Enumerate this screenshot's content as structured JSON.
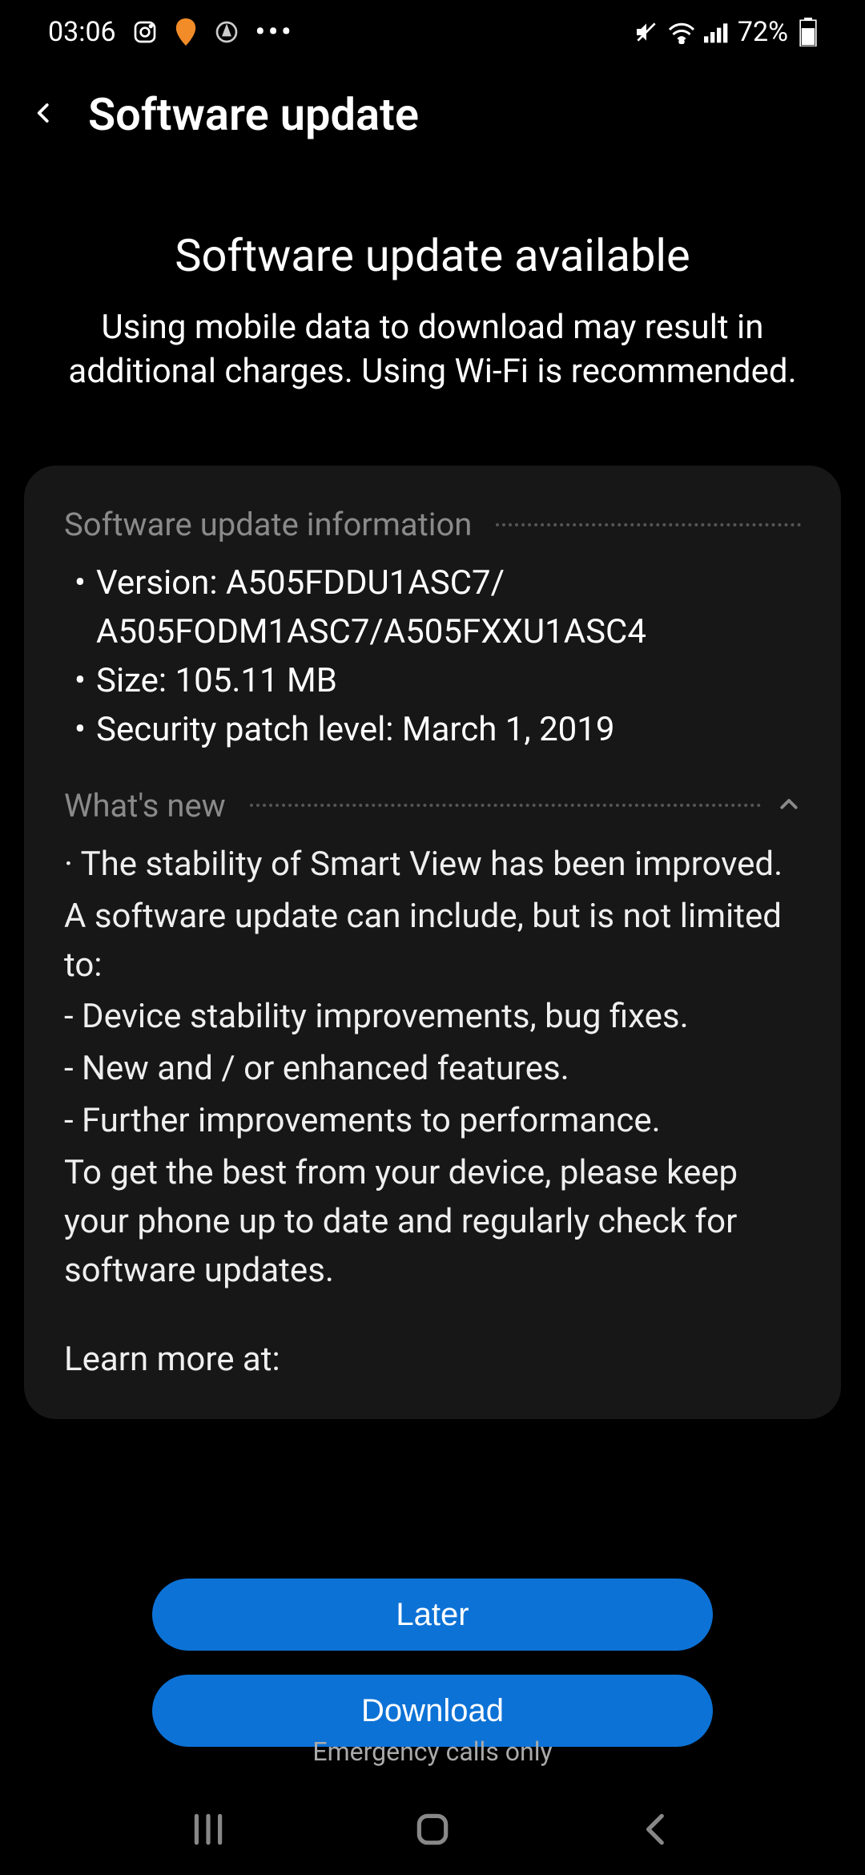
{
  "status_bar": {
    "time": "03:06",
    "battery_percent": "72%"
  },
  "app_bar": {
    "title": "Software update"
  },
  "header": {
    "title": "Software update available",
    "subtitle": "Using mobile data to download may result in additional charges. Using Wi-Fi is recommended."
  },
  "info_section": {
    "heading": "Software update information",
    "items": {
      "version_label": "Version: A505FDDU1ASC7/",
      "version_line2": "A505FODM1ASC7/A505FXXU1ASC4",
      "size": "Size: 105.11 MB",
      "security_patch": "Security patch level: March 1, 2019"
    }
  },
  "whats_new": {
    "heading": "What's new",
    "line1": "· The stability of Smart View has been improved.",
    "line2": "A software update can include, but is not limited to:",
    "bullet1": " - Device stability improvements, bug fixes.",
    "bullet2": " - New and / or enhanced features.",
    "bullet3": " - Further improvements to performance.",
    "line3": "To get the best from your device, please keep your phone up to date and regularly check for software updates.",
    "learn_more": "Learn more at:"
  },
  "buttons": {
    "later": "Later",
    "download": "Download"
  },
  "emergency": "Emergency calls only"
}
